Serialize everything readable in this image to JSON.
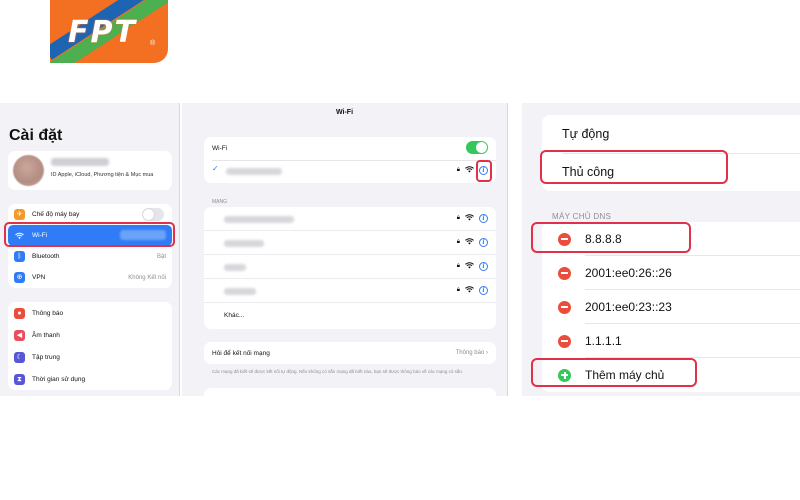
{
  "brand": {
    "logo_text": "FPT",
    "registered_mark": "®",
    "color": "#f36f21"
  },
  "settings": {
    "title": "Cài đặt",
    "profile_sub": "ID Apple, iCloud, Phương tiện & Mục mua",
    "group1": [
      {
        "label": "Chế độ máy bay",
        "icon": "airplane-icon",
        "value": ""
      },
      {
        "label": "Wi-Fi",
        "icon": "wifi-icon",
        "value": ""
      },
      {
        "label": "Bluetooth",
        "icon": "bluetooth-icon",
        "value": "Bật"
      },
      {
        "label": "VPN",
        "icon": "vpn-icon",
        "value": "Không Kết nối"
      }
    ],
    "group2": [
      {
        "label": "Thông báo",
        "icon": "bell-icon"
      },
      {
        "label": "Âm thanh",
        "icon": "speaker-icon"
      },
      {
        "label": "Tập trung",
        "icon": "moon-icon"
      },
      {
        "label": "Thời gian sử dụng",
        "icon": "hourglass-icon"
      }
    ]
  },
  "wifi": {
    "title": "Wi-Fi",
    "toggle_label": "Wi-Fi",
    "networks_header": "MẠNG",
    "other_label": "Khác...",
    "ask_label": "Hỏi để kết nối mạng",
    "ask_value": "Thông báo",
    "ask_note": "Các mạng đã biết sẽ được kết nối tự động. Nếu không có sẵn mạng đã biết nào, bạn sẽ được thông báo về các mạng có sẵn."
  },
  "dns": {
    "mode_auto": "Tự động",
    "mode_manual": "Thủ công",
    "section_header": "MÁY CHỦ DNS",
    "servers": [
      "8.8.8.8",
      "2001:ee0:26::26",
      "2001:ee0:23::23",
      "1.1.1.1"
    ],
    "add_label": "Thêm máy chủ"
  },
  "colors": {
    "accent_blue": "#2f7cf6",
    "highlight_red": "#e03148",
    "green": "#34c759",
    "remove_red": "#eb4d3d"
  }
}
